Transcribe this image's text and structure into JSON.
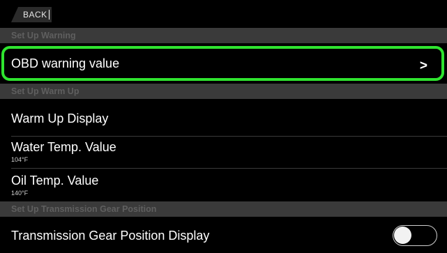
{
  "topbar": {
    "back_label": "BACK"
  },
  "sections": {
    "warning": {
      "header": "Set Up Warning",
      "obd_label": "OBD warning value",
      "obd_chevron": ">"
    },
    "warmup": {
      "header": "Set Up Warm Up",
      "display_label": "Warm Up Display",
      "water_label": "Water Temp. Value",
      "water_value": "104°F",
      "oil_label": "Oil Temp. Value",
      "oil_value": "140°F"
    },
    "transmission": {
      "header": "Set Up Transmission Gear Position",
      "display_label": "Transmission Gear Position Display",
      "display_on": false
    }
  },
  "colors": {
    "highlight": "#2fe42f",
    "section_bg": "#3a3a3a",
    "row_bg": "#000000"
  }
}
